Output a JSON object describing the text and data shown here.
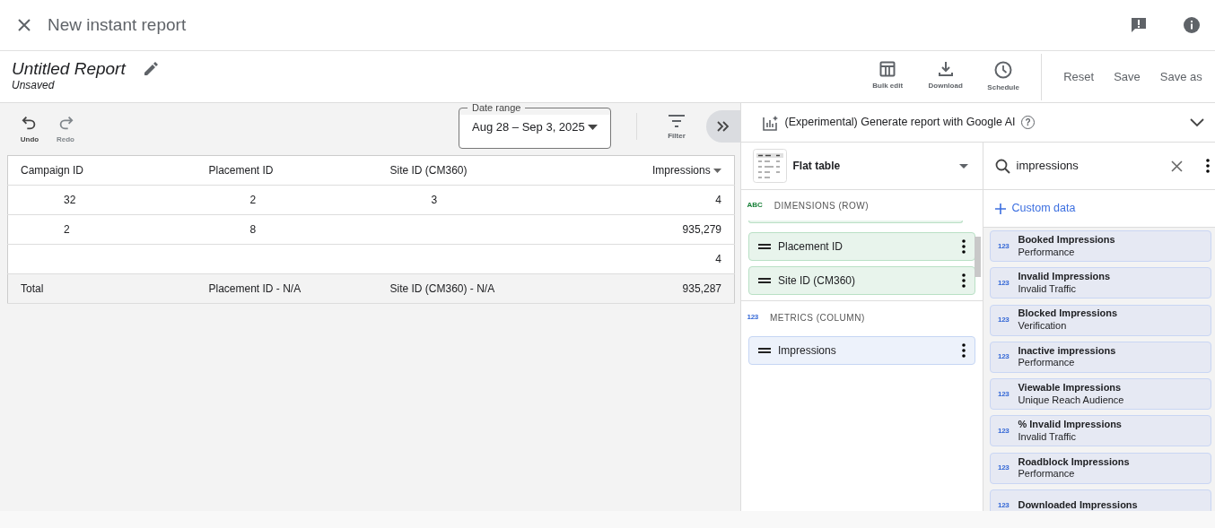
{
  "window": {
    "title": "New instant report"
  },
  "report": {
    "title": "Untitled Report",
    "status": "Unsaved"
  },
  "header_actions": [
    {
      "label": "Bulk edit",
      "kind": "table"
    },
    {
      "label": "Download",
      "kind": "download"
    },
    {
      "label": "Schedule",
      "kind": "clock"
    }
  ],
  "header_buttons": [
    "Reset",
    "Save",
    "Save as"
  ],
  "toolbar": {
    "undo": {
      "label": "Undo",
      "disabled": false
    },
    "redo": {
      "label": "Redo",
      "disabled": true
    },
    "date_range": {
      "label": "Date range",
      "value": "Aug 28 – Sep 3, 2025"
    },
    "filter": {
      "label": "Filter"
    }
  },
  "table": {
    "columns": [
      {
        "label": "Campaign ID",
        "sorted": false
      },
      {
        "label": "Placement ID",
        "sorted": false
      },
      {
        "label": "Site ID (CM360)",
        "sorted": false
      },
      {
        "label": "Impressions",
        "sorted": true
      }
    ],
    "rows": [
      [
        "32",
        "2",
        "3",
        "4"
      ],
      [
        "2",
        "8",
        null,
        "935,279"
      ],
      [
        null,
        null,
        null,
        "4"
      ]
    ],
    "total": [
      "Total",
      "Placement ID - N/A",
      "Site ID (CM360) - N/A",
      "935,287"
    ]
  },
  "ai_bar": {
    "label": "(Experimental) Generate report with Google AI",
    "help": "?",
    "expanded": false
  },
  "chart_type": {
    "label": "Flat table"
  },
  "dimensions": {
    "badge": "ABC",
    "label": "DIMENSIONS (ROW)",
    "items": [
      "Placement ID",
      "Site ID (CM360)"
    ]
  },
  "metrics": {
    "badge": "123",
    "label": "METRICS (COLUMN)",
    "items": [
      "Impressions"
    ]
  },
  "search": {
    "value": "impressions"
  },
  "custom_data": "Custom data",
  "results": [
    {
      "badge": "123",
      "name": "Booked Impressions",
      "category": "Performance"
    },
    {
      "badge": "123",
      "name": "Invalid Impressions",
      "category": "Invalid Traffic"
    },
    {
      "badge": "123",
      "name": "Blocked Impressions",
      "category": "Verification"
    },
    {
      "badge": "123",
      "name": "Inactive impressions",
      "category": "Performance"
    },
    {
      "badge": "123",
      "name": "Viewable Impressions",
      "category": "Unique Reach Audience"
    },
    {
      "badge": "123",
      "name": "% Invalid Impressions",
      "category": "Invalid Traffic"
    },
    {
      "badge": "123",
      "name": "Roadblock Impressions",
      "category": "Performance"
    },
    {
      "badge": "123",
      "name": "Downloaded Impressions"
    }
  ]
}
